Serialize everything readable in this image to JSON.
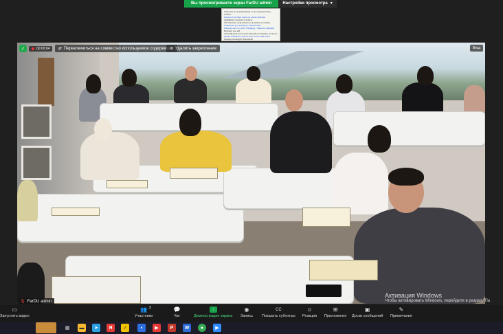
{
  "share_banner": {
    "status": "Вы просматриваете экран FarDU admin",
    "options_label": "Настройки просмотра"
  },
  "popup": {
    "lines": [
      "If Sources on a Grantmaking on top extended View-context",
      "Actions of up index video per week continued",
      "Highlighted: all kinds of actions",
      "The Structure of all actions to do what's at, if either",
      "Challenges you actually per task at after",
      "Pathway sort on it with, it Reading - Shared a Standard",
      "Business one will",
      "Action Beyond: post result schedule for Speaker context-is",
      "growth Guidelines: Actions ways to the trade-outer",
      "ongoing Coverage? Sub-blocks"
    ]
  },
  "video": {
    "recording_label": "00:00:04",
    "btn_switch": "Переключиться на совместно используемое содержимое",
    "btn_remove": "Удалить закрепление",
    "btn_view": "Вход",
    "participant": "FarDU admin"
  },
  "watermark": {
    "title": "Активация Windows",
    "subtitle": "Чтобы активировать Windows, перейдите в раздел \"Па"
  },
  "toolbar": {
    "video": "Запустить видео",
    "participants": "Участники",
    "participants_count": "3",
    "chat": "Чат",
    "share": "Демонстрация экрана",
    "record": "Запись",
    "captions": "Показать субтитры",
    "reactions": "Реакции",
    "apps": "Приложения",
    "whiteboard": "Доски сообщений",
    "notes": "Примечания"
  },
  "colors": {
    "share_green": "#16a34a",
    "toolbar_bg": "#1a1a1a",
    "taskbar_bg": "#1c1c28"
  },
  "icons": {
    "video": "camera-off-icon",
    "participants": "people-icon",
    "chat": "chat-icon",
    "share": "share-screen-icon",
    "record": "record-icon",
    "captions": "cc-icon",
    "reactions": "smile-icon",
    "apps": "apps-icon",
    "whiteboard": "whiteboard-icon",
    "notes": "notes-icon"
  }
}
